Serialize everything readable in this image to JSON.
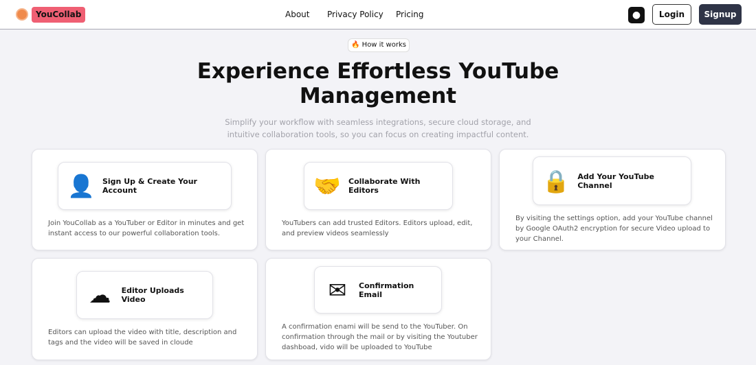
{
  "header": {
    "brand": "YouCollab",
    "nav": [
      "About",
      "Privacy Policy",
      "Pricing"
    ],
    "login": "Login",
    "signup": "Signup"
  },
  "hero": {
    "badge": "How it works",
    "title": "Experience Effortless YouTube Management",
    "subtitle": "Simplify your workflow with seamless integrations, secure cloud storage, and intuitive collaboration tools, so you can focus on creating impactful content."
  },
  "cards": [
    {
      "title": "Sign Up & Create Your Account",
      "desc": "Join YouCollab as a YouTuber or Editor in minutes and get instant access to our powerful collaboration tools.",
      "icon": "👤"
    },
    {
      "title": "Collaborate With Editors",
      "desc": "YouTubers can add trusted Editors. Editors upload, edit, and preview videos seamlessly",
      "icon": "🤝"
    },
    {
      "title": "Add Your YouTube Channel",
      "desc": "By visiting the settings option, add your YouTube channel by Google OAuth2 encryption for secure Video upload to your Channel.",
      "icon": "🔒"
    },
    {
      "title": "Editor Uploads Video",
      "desc": "Editors can upload the video with title, description and tags and the video will be saved in cloude",
      "icon": "☁"
    },
    {
      "title": "Confirmation Email",
      "desc": "A confirmation enami will be send to the YouTuber. On confirmation through the mail or by visiting the Youtuber dashboad, vido will be uploaded to YouTube",
      "icon": "✉"
    }
  ]
}
